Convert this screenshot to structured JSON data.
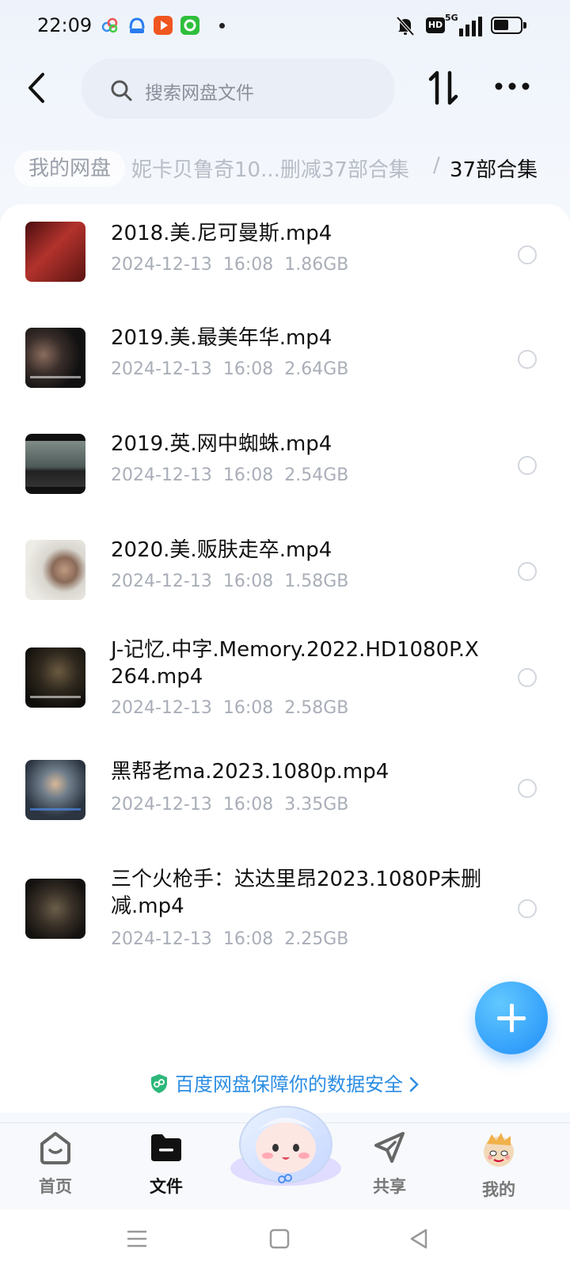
{
  "status_bar": {
    "time": "22:09",
    "hd_label": "HD",
    "network_label": "5G",
    "app_icons": [
      "cloud-app-icon",
      "baidu-app-icon",
      "video-app-icon",
      "camera-app-icon"
    ]
  },
  "header": {
    "search_placeholder": "搜索网盘文件",
    "back_icon": "chevron-left-icon",
    "sort_icon": "sort-icon",
    "more_icon": "more-icon"
  },
  "breadcrumb": {
    "root": "我的网盘",
    "middle": "妮卡贝鲁奇10...删减37部合集",
    "separator": "/",
    "current": "37部合集"
  },
  "files": [
    {
      "name": "2018.美.尼可曼斯.mp4",
      "date": "2024-12-13",
      "time": "16:08",
      "size": "1.86GB"
    },
    {
      "name": "2019.美.最美年华.mp4",
      "date": "2024-12-13",
      "time": "16:08",
      "size": "2.64GB"
    },
    {
      "name": "2019.英.网中蜘蛛.mp4",
      "date": "2024-12-13",
      "time": "16:08",
      "size": "2.54GB"
    },
    {
      "name": "2020.美.贩肤走卒.mp4",
      "date": "2024-12-13",
      "time": "16:08",
      "size": "1.58GB"
    },
    {
      "name": "J-记忆.中字.Memory.2022.HD1080P.X264.mp4",
      "date": "2024-12-13",
      "time": "16:08",
      "size": "2.58GB"
    },
    {
      "name": "黑帮老ma.2023.1080p.mp4",
      "date": "2024-12-13",
      "time": "16:08",
      "size": "3.35GB"
    },
    {
      "name": "三个火枪手：达达里昂2023.1080P未删减.mp4",
      "date": "2024-12-13",
      "time": "16:08",
      "size": "2.25GB"
    }
  ],
  "security_note": "百度网盘保障你的数据安全",
  "tabs": [
    {
      "label": "首页",
      "icon": "home-icon"
    },
    {
      "label": "文件",
      "icon": "folder-icon"
    },
    {
      "label": "共享",
      "icon": "send-icon"
    },
    {
      "label": "我的",
      "icon": "avatar-icon"
    }
  ],
  "colors": {
    "accent": "#2c8de3",
    "fab": "#1f8ef8",
    "meta_text": "#a9aeb8"
  }
}
